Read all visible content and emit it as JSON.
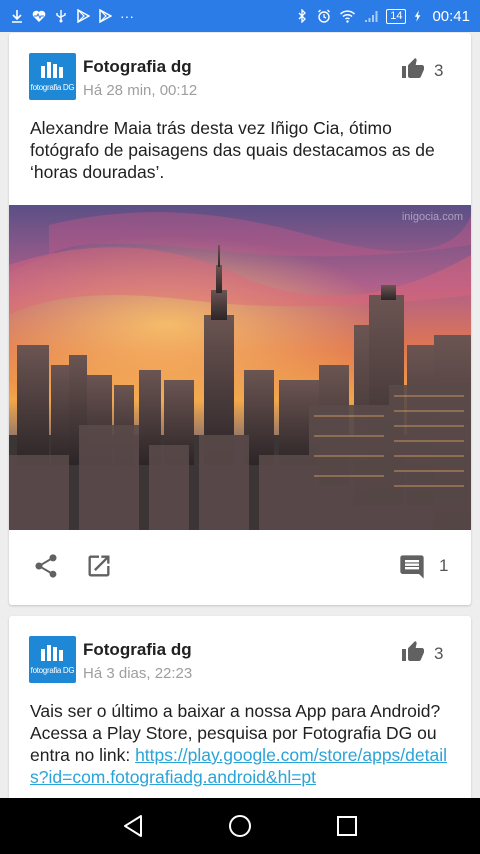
{
  "status_bar": {
    "time": "00:41",
    "battery": "14",
    "left_icons": [
      "download-icon",
      "heart-monitor-icon",
      "usb-icon",
      "play-store-icon",
      "play-store-icon",
      "more-notifications-icon"
    ],
    "right_icons": [
      "bluetooth-icon",
      "alarm-icon",
      "wifi-icon",
      "signal-icon",
      "battery-icon",
      "charging-icon"
    ],
    "more_label": "···"
  },
  "posts": [
    {
      "page_name": "Fotografia dg",
      "time": "Há 28 min, 00:12",
      "likes": "3",
      "text": "Alexandre Maia trás desta vez Iñigo Cia, ótimo fotógrafo de paisagens das quais destacamos as de ‘horas douradas’.",
      "image_credit": "inigocia.com",
      "comments": "1",
      "logo_text": "fotografia DG"
    },
    {
      "page_name": "Fotografia dg",
      "time": "Há 3 dias, 22:23",
      "likes": "3",
      "text": "Vais ser o último a baixar a nossa App para Android? Acessa a Play Store, pesquisa por Fotografia DG ou entra no link: ",
      "link": "https://play.google.com/store/apps/details?id=com.fotografiadg.android&hl=pt",
      "logo_text": "fotografia DG"
    }
  ],
  "colors": {
    "status_bar": "#2c7ce8",
    "logo": "#1e88d6",
    "link": "#2aa4d8",
    "background": "#eeeeee"
  },
  "nav_bar": {
    "icons": [
      "back-icon",
      "home-icon",
      "recents-icon"
    ]
  }
}
